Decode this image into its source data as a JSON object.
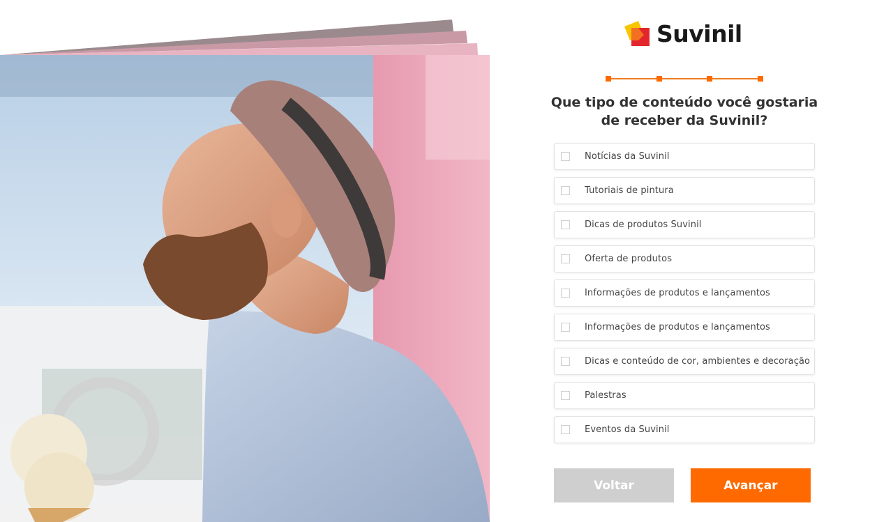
{
  "brand": {
    "name": "Suvinil",
    "colors": {
      "accent": "#ff6a00",
      "logo_yellow": "#f7c600",
      "logo_red": "#e3262b",
      "logo_orange": "#f36f21"
    }
  },
  "stepper": {
    "total_steps": 4,
    "current_step": 4
  },
  "form": {
    "question": "Que tipo de conteúdo você gostaria de receber da Suvinil?",
    "options": [
      {
        "label": "Notícias da Suvinil",
        "checked": false
      },
      {
        "label": "Tutoriais de pintura",
        "checked": false
      },
      {
        "label": "Dicas de produtos Suvinil",
        "checked": false
      },
      {
        "label": "Oferta de produtos",
        "checked": false
      },
      {
        "label": "Informações de produtos e lançamentos",
        "checked": false
      },
      {
        "label": "Informações de produtos e lançamentos",
        "checked": false
      },
      {
        "label": "Dicas e conteúdo de cor, ambientes e decoração",
        "checked": false
      },
      {
        "label": "Palestras",
        "checked": false
      },
      {
        "label": "Eventos da Suvinil",
        "checked": false
      }
    ]
  },
  "buttons": {
    "back_label": "Voltar",
    "next_label": "Avançar"
  },
  "illustration": {
    "icon": "man-with-hat-photo"
  }
}
